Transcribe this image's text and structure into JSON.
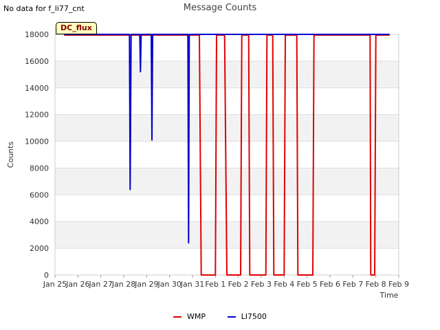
{
  "no_data_text": "No data for f_li77_cnt",
  "chart_data": {
    "type": "line",
    "title": "Message Counts",
    "xlabel": "Time",
    "ylabel": "Counts",
    "ylim": [
      0,
      18000
    ],
    "yticks": [
      0,
      2000,
      4000,
      6000,
      8000,
      10000,
      12000,
      14000,
      16000,
      18000
    ],
    "xlim": [
      0,
      15
    ],
    "xticks": [
      {
        "v": 0,
        "label": "Jan 25"
      },
      {
        "v": 1,
        "label": "Jan 26"
      },
      {
        "v": 2,
        "label": "Jan 27"
      },
      {
        "v": 3,
        "label": "Jan 28"
      },
      {
        "v": 4,
        "label": "Jan 29"
      },
      {
        "v": 5,
        "label": "Jan 30"
      },
      {
        "v": 6,
        "label": "Jan 31"
      },
      {
        "v": 7,
        "label": "Feb 1"
      },
      {
        "v": 8,
        "label": "Feb 2"
      },
      {
        "v": 9,
        "label": "Feb 3"
      },
      {
        "v": 10,
        "label": "Feb 4"
      },
      {
        "v": 11,
        "label": "Feb 5"
      },
      {
        "v": 12,
        "label": "Feb 6"
      },
      {
        "v": 13,
        "label": "Feb 7"
      },
      {
        "v": 14,
        "label": "Feb 8"
      },
      {
        "v": 15,
        "label": "Feb 9"
      }
    ],
    "grid": true,
    "legend_position": "bottom-center",
    "annotation": "DC_flux",
    "series": [
      {
        "name": "WMP",
        "color": "#e00000",
        "points": [
          [
            0.4,
            17950
          ],
          [
            6.3,
            17950
          ],
          [
            6.38,
            0
          ],
          [
            7.0,
            0
          ],
          [
            7.05,
            17950
          ],
          [
            7.4,
            17950
          ],
          [
            7.5,
            0
          ],
          [
            8.1,
            0
          ],
          [
            8.15,
            17950
          ],
          [
            8.45,
            17950
          ],
          [
            8.5,
            0
          ],
          [
            9.2,
            0
          ],
          [
            9.25,
            17950
          ],
          [
            9.5,
            17950
          ],
          [
            9.55,
            0
          ],
          [
            10.0,
            0
          ],
          [
            10.05,
            17950
          ],
          [
            10.55,
            17950
          ],
          [
            10.6,
            0
          ],
          [
            11.25,
            0
          ],
          [
            11.3,
            17950
          ],
          [
            13.75,
            17950
          ],
          [
            13.78,
            0
          ],
          [
            13.95,
            0
          ],
          [
            14.0,
            17950
          ],
          [
            14.6,
            17950
          ]
        ]
      },
      {
        "name": "LI7500",
        "color": "#0000cc",
        "points": [
          [
            0.4,
            18000
          ],
          [
            3.25,
            18000
          ],
          [
            3.28,
            6400
          ],
          [
            3.32,
            18000
          ],
          [
            3.7,
            18000
          ],
          [
            3.73,
            15200
          ],
          [
            3.76,
            18000
          ],
          [
            4.2,
            18000
          ],
          [
            4.23,
            10100
          ],
          [
            4.26,
            18000
          ],
          [
            5.8,
            18000
          ],
          [
            5.83,
            2400
          ],
          [
            5.86,
            18000
          ],
          [
            14.6,
            18000
          ]
        ]
      }
    ]
  }
}
